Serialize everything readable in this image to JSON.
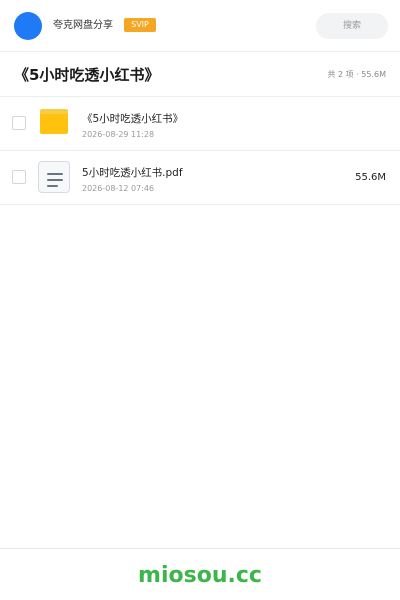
{
  "header": {
    "app_name": "夸克网盘分享",
    "badge": "SVIP",
    "search_placeholder": "搜索"
  },
  "folder": {
    "title": "《5小时吃透小红书》",
    "summary": "共 2 项 · 55.6M"
  },
  "files": [
    {
      "type": "folder",
      "name": "《5小时吃透小红书》",
      "date": "2026-08-29 11:28",
      "size": ""
    },
    {
      "type": "pdf",
      "name": "5小时吃透小红书.pdf",
      "date": "2026-08-12 07:46",
      "size": "55.6M"
    }
  ],
  "footer": {
    "brand": "miosou.cc"
  },
  "colors": {
    "accent": "#1f7af5",
    "badge": "#f5a623",
    "folder": "#ffc20e",
    "brand": "#3cb54a"
  }
}
